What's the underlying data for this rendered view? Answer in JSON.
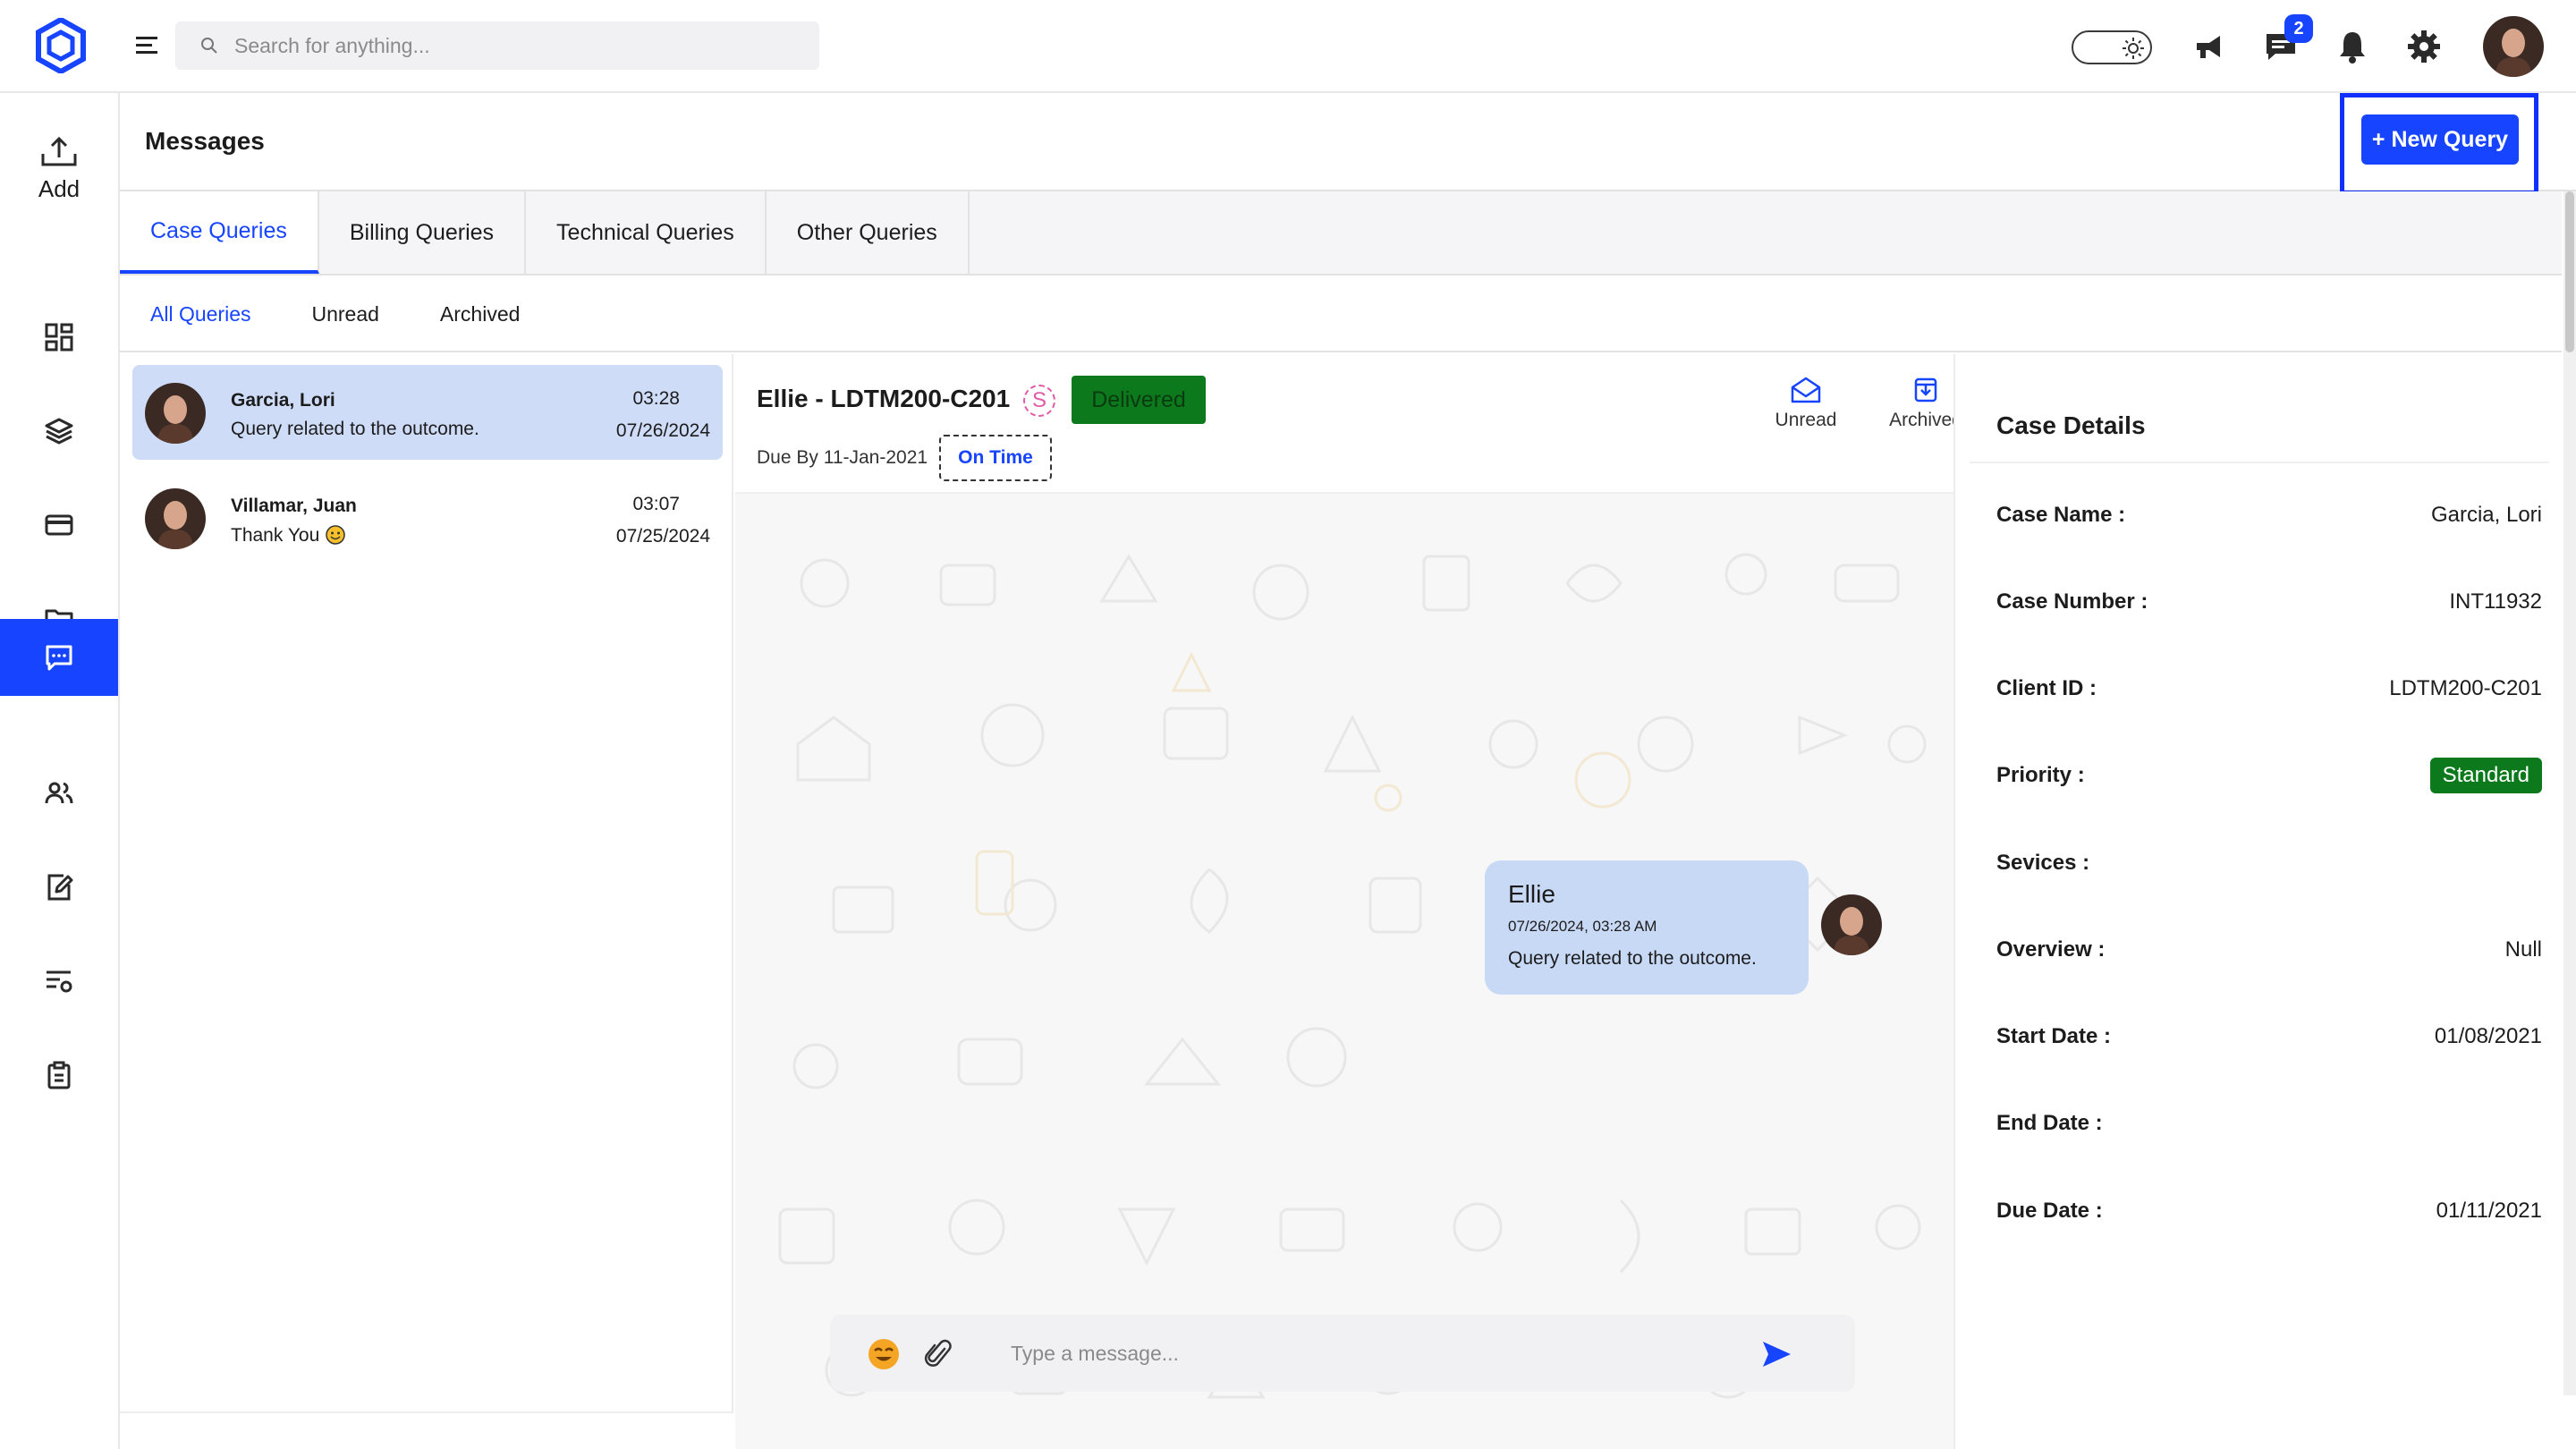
{
  "header": {
    "search_placeholder": "Search for anything...",
    "messages_badge": "2"
  },
  "sidebar": {
    "add_label": "Add"
  },
  "page": {
    "title": "Messages",
    "new_query_label": "+ New Query"
  },
  "tabs": [
    {
      "label": "Case Queries",
      "active": true
    },
    {
      "label": "Billing Queries",
      "active": false
    },
    {
      "label": "Technical Queries",
      "active": false
    },
    {
      "label": "Other Queries",
      "active": false
    }
  ],
  "subtabs": [
    {
      "label": "All Queries",
      "active": true
    },
    {
      "label": "Unread",
      "active": false
    },
    {
      "label": "Archived",
      "active": false
    }
  ],
  "conversations": [
    {
      "name": "Garcia, Lori",
      "preview": "Query related to the outcome.",
      "time": "03:28",
      "date": "07/26/2024"
    },
    {
      "name": "Villamar, Juan",
      "preview": "Thank You",
      "time": "03:07",
      "date": "07/25/2024"
    }
  ],
  "thread": {
    "title": "Ellie - LDTM200-C201",
    "s_badge": "S",
    "status": "Delivered",
    "due_by": "Due By 11-Jan-2021",
    "timeliness": "On Time",
    "unread_label": "Unread",
    "archived_label": "Archived",
    "message": {
      "sender": "Ellie",
      "datetime": "07/26/2024, 03:28 AM",
      "text": "Query related to the outcome."
    },
    "composer_placeholder": "Type a message..."
  },
  "case_details": {
    "title": "Case Details",
    "rows": [
      {
        "label": "Case Name :",
        "value": "Garcia, Lori"
      },
      {
        "label": "Case Number :",
        "value": "INT11932"
      },
      {
        "label": "Client ID :",
        "value": "LDTM200-C201"
      },
      {
        "label": "Priority :",
        "value": "Standard"
      },
      {
        "label": "Sevices :",
        "value": ""
      },
      {
        "label": "Overview :",
        "value": "Null"
      },
      {
        "label": "Start Date :",
        "value": "01/08/2021"
      },
      {
        "label": "End Date :",
        "value": ""
      },
      {
        "label": "Due Date :",
        "value": "01/11/2021"
      }
    ]
  },
  "colors": {
    "accent": "#1744ff",
    "selected_item": "#cfdcf8",
    "bubble": "#c8d9f6",
    "status_green": "#0c7a1c"
  }
}
